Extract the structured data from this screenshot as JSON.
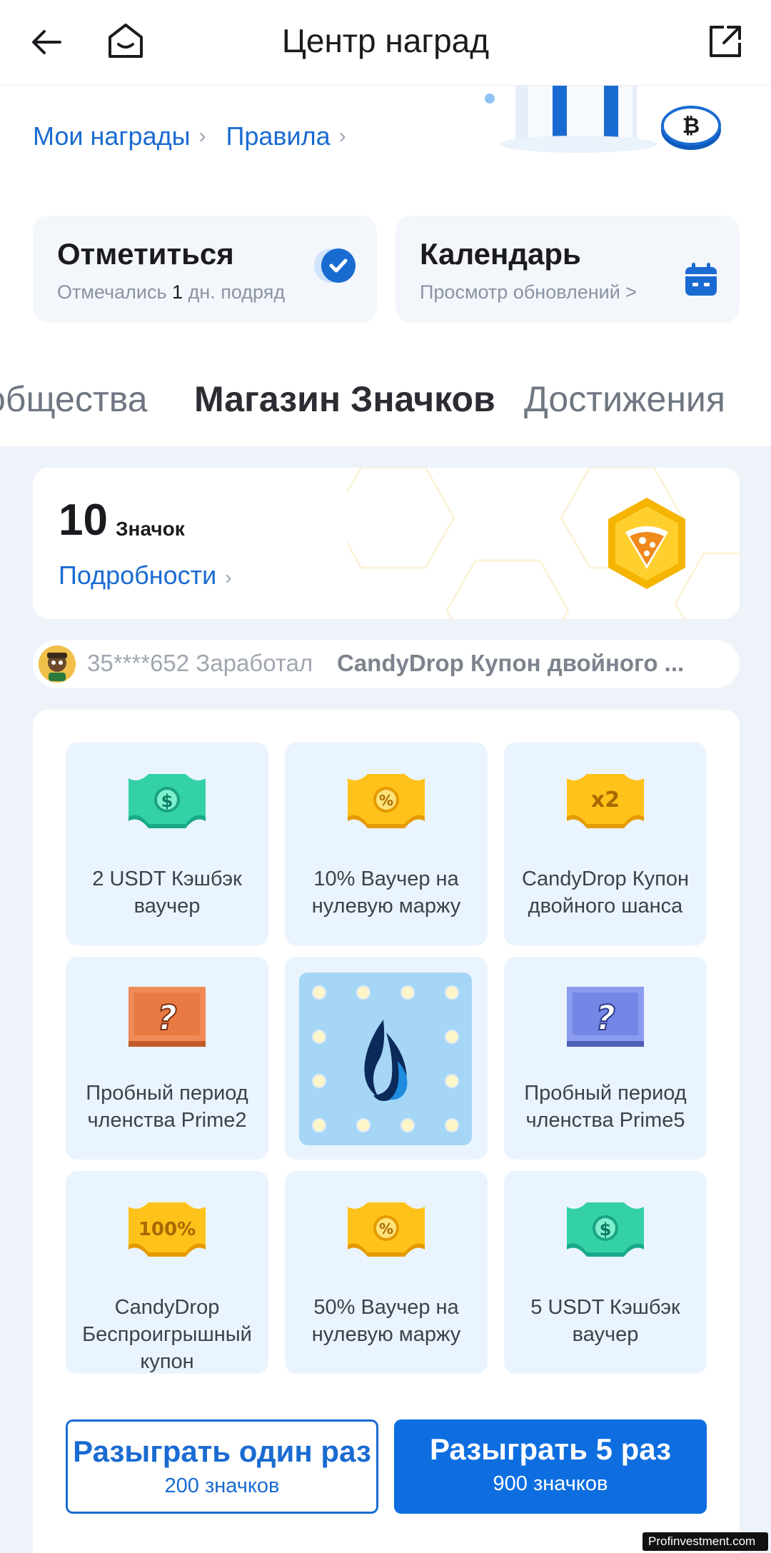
{
  "header": {
    "title": "Центр наград"
  },
  "links": {
    "my_rewards": "Мои награды",
    "rules": "Правила"
  },
  "checkin": {
    "title": "Отметиться",
    "sub_before": "Отмечались ",
    "days": "1",
    "sub_after": " дн. подряд"
  },
  "calendar": {
    "title": "Календарь",
    "subtitle": "Просмотр обновлений >"
  },
  "tabs": [
    {
      "label": "общества"
    },
    {
      "label": "Магазин Значков",
      "active": true
    },
    {
      "label": "Достижения"
    }
  ],
  "badges": {
    "count": "10",
    "unit": "Значок",
    "details": "Подробности"
  },
  "ticker": {
    "user": "35****652 Заработал",
    "prize": "CandyDrop Купон двойного ..."
  },
  "prizes": [
    {
      "label": "2 USDT Кэшбэк ваучер",
      "icon": "dollar-coupon-green-icon"
    },
    {
      "label": "10% Ваучер на нулевую маржу",
      "icon": "percent-coupon-yellow-icon"
    },
    {
      "label": "CandyDrop Купон двойного шанса",
      "icon": "x2-coupon-yellow-icon"
    },
    {
      "label": "Пробный период членства Prime2",
      "icon": "mystery-box-orange-icon"
    },
    {
      "label": "",
      "icon": "huobi-flame-logo-icon"
    },
    {
      "label": "Пробный период членства Prime5",
      "icon": "mystery-box-blue-icon"
    },
    {
      "label": "CandyDrop Беспроигрышный купон",
      "icon": "100-percent-coupon-yellow-icon"
    },
    {
      "label": "50% Ваучер на нулевую маржу",
      "icon": "percent-coupon-yellow-icon"
    },
    {
      "label": "5 USDT Кэшбэк ваучер",
      "icon": "dollar-coupon-green-icon"
    }
  ],
  "actions": {
    "once_label": "Разыграть один раз",
    "once_cost": "200 значков",
    "five_label": "Разыграть 5 раз",
    "five_cost": "900 значков"
  },
  "watermark": "Profinvestment.com",
  "colors": {
    "accent": "#1a6bd1",
    "primary_button": "#0e6ee0",
    "tile_bg": "#eaf4fe",
    "badge_gold": "#f5b400"
  }
}
